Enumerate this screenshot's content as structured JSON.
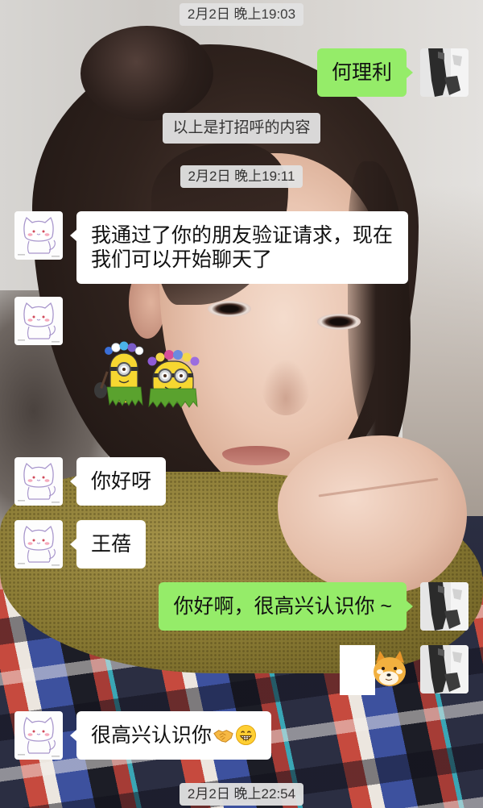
{
  "chat": [
    {
      "timestamp": "2月2日 晚上19:03"
    },
    {
      "outgoing": true,
      "text": "何理利"
    },
    {
      "system": "以上是打招呼的内容"
    },
    {
      "timestamp": "2月2日 晚上19:11"
    },
    {
      "outgoing": false,
      "text": "我通过了你的朋友验证请求，现在我们可以开始聊天了"
    },
    {
      "outgoing": false,
      "sticker_icon": "minions-flower-crown-sticker"
    },
    {
      "outgoing": false,
      "text": "你好呀"
    },
    {
      "outgoing": false,
      "text": "王蓓"
    },
    {
      "outgoing": true,
      "text": "你好啊，很高兴认识你 ~"
    },
    {
      "outgoing": true,
      "sticker_icon": "shiba-dog-sticker"
    },
    {
      "outgoing": false,
      "text": "很高兴认识你",
      "emoji_icons": [
        "handshake-icon",
        "grinning-face-icon"
      ]
    },
    {
      "timestamp": "2月2日 晚上22:54"
    }
  ],
  "avatars": {
    "outgoing_icon": "photo-avatar-icon",
    "incoming_icon": "white-cat-avatar-icon"
  },
  "colors": {
    "outgoing_bubble": "#95ec69",
    "incoming_bubble": "#ffffff",
    "message_text": "#111111",
    "timestamp_pill": "#e2e2e2",
    "timestamp_text": "#353535"
  }
}
